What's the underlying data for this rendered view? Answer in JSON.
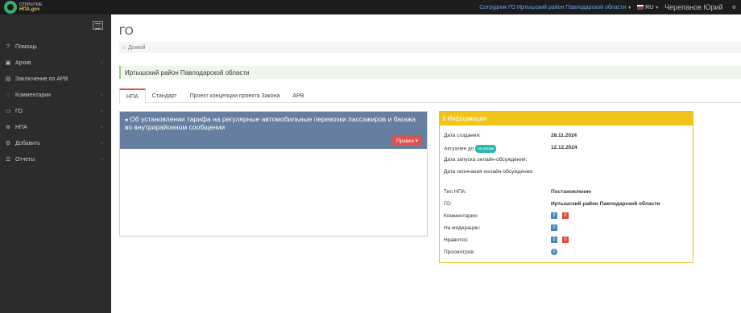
{
  "header": {
    "logo_line1": "ОТКРЫТЫЕ",
    "logo_line2": "НПА.gov",
    "user_role": "Сотрудник ГО Иртышский район Павлодарской области",
    "language": "RU",
    "user_name": "Черепанов Юрий"
  },
  "sidebar": {
    "items": [
      {
        "icon": "?",
        "label": "Помощь",
        "arrow": ""
      },
      {
        "icon": "▣",
        "label": "Архив",
        "arrow": "‹"
      },
      {
        "icon": "▤",
        "label": "Заключение по АРВ",
        "arrow": ""
      },
      {
        "icon": "◌",
        "label": "Комментарии",
        "arrow": "‹"
      },
      {
        "icon": "▭",
        "label": "ГО",
        "arrow": "‹"
      },
      {
        "icon": "⊕",
        "label": "НПА",
        "arrow": "‹"
      },
      {
        "icon": "⚙",
        "label": "Добавить",
        "arrow": "‹"
      },
      {
        "icon": "☰",
        "label": "Отчеты",
        "arrow": "‹"
      }
    ]
  },
  "page": {
    "title": "ГО",
    "breadcrumb": "Домой",
    "alert": "Иртышский район Павлодарской области"
  },
  "tabs": [
    "НПА",
    "Стандарт",
    "Проект концепции проекта Закона",
    "АРВ"
  ],
  "document": {
    "title": "Об установлении тарифа на регулярные автомобильные перевозки пассажиров и багажа во внутрирайонном сообщении",
    "edit_button": "Правка"
  },
  "info": {
    "header": "Информация",
    "created_label": "Дата создания:",
    "created_value": "28.11.2024",
    "actual_label": "Актуален до",
    "actual_badge": "не указан",
    "actual_value": "12.12.2024",
    "discussion_start_label": "Дата запуска онлайн-обсуждения:",
    "discussion_end_label": "Дата окончания онлайн-обсуждения:",
    "type_label": "Тип НПА:",
    "type_value": "Постановление",
    "go_label": "ГО:",
    "go_value": "Иртышский район Павлодарской области",
    "comments_label": "Комментарии:",
    "comments_count": "0",
    "comments_extra": "0",
    "moderation_label": "На модерации:",
    "moderation_count": "0",
    "likes_label": "Нравится:",
    "likes_count": "0",
    "dislikes_count": "0",
    "views_label": "Просмотров:",
    "views_count": "0"
  },
  "colors": {
    "topbar": "#1c1c1c",
    "sidebar": "#2c2c2c",
    "doc_header": "#667fa0",
    "info_header": "#f0c419",
    "danger": "#d9534f",
    "primary": "#3c8dbc"
  }
}
